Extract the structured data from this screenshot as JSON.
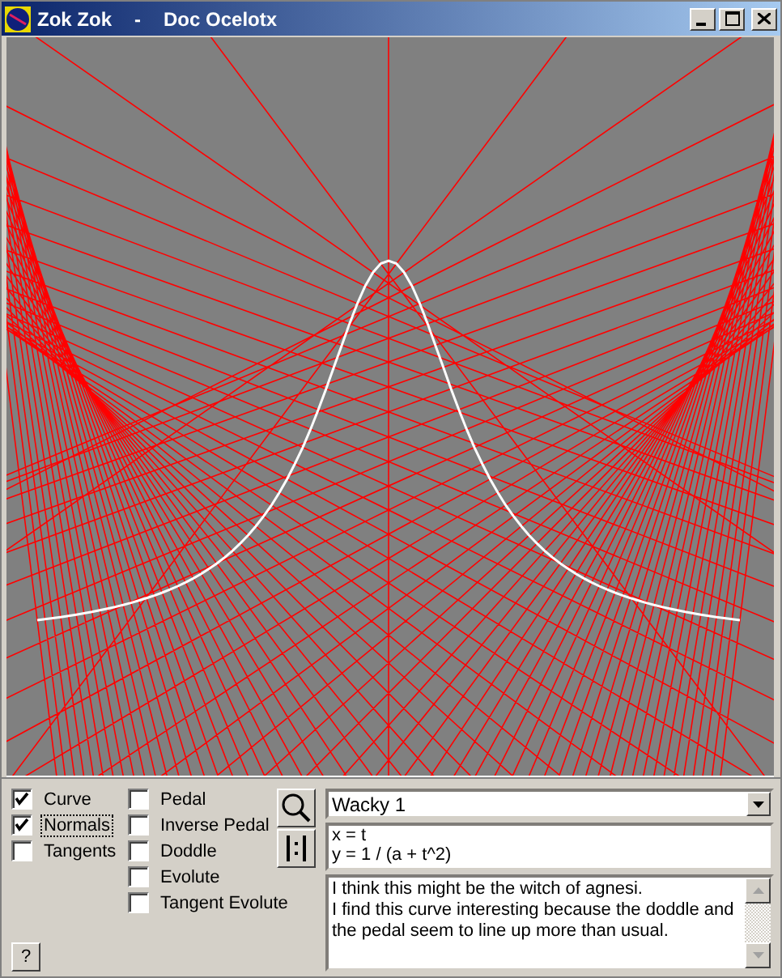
{
  "window": {
    "title": "Zok Zok",
    "separator": "-",
    "document": "Doc Ocelotx"
  },
  "options": [
    {
      "label": "Curve",
      "checked": true,
      "focused": false
    },
    {
      "label": "Normals",
      "checked": true,
      "focused": true
    },
    {
      "label": "Tangents",
      "checked": false,
      "focused": false
    }
  ],
  "constructions": [
    {
      "label": "Pedal",
      "checked": false
    },
    {
      "label": "Inverse Pedal",
      "checked": false
    },
    {
      "label": "Doddle",
      "checked": false
    },
    {
      "label": "Evolute",
      "checked": false
    },
    {
      "label": "Tangent Evolute",
      "checked": false
    }
  ],
  "help_button": "?",
  "curve_select": {
    "value": "Wacky 1"
  },
  "equations": [
    "x = t",
    "y = 1 / (a + t^2)"
  ],
  "notes": [
    "I think this might be the witch of agnesi.",
    "I find this curve interesting because the doddle and the pedal seem to line up more than usual."
  ]
}
